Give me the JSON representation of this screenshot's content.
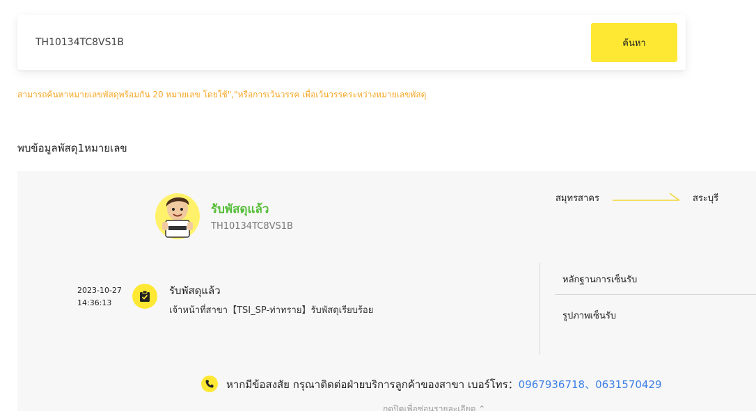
{
  "search": {
    "value": "TH10134TC8VS1B",
    "button_label": "ค้นหา"
  },
  "hint_text": "สามารถค้นหาหมายเลขพัสดุพร้อมกัน 20 หมายเลข โดยใช้\",\"หรือการเว้นวรรค เพื่อเว้นวรรคระหว่างหมายเลขพัสดุ",
  "results": {
    "found_text": "พบข้อมูลพัสดุ1หมายเลข",
    "status": "รับพัสดุแล้ว",
    "tracking_number": "TH10134TC8VS1B",
    "route": {
      "from": "สมุทรสาคร",
      "to": "สระบุรี"
    },
    "event": {
      "date": "2023-10-27",
      "time": "14:36:13",
      "title": "รับพัสดุแล้ว",
      "description": "เจ้าหน้าที่สาขา【TSI_SP-ท่าทราย】รับพัสดุเรียบร้อย"
    },
    "side_links": {
      "proof": "หลักฐานการเซ็นรับ",
      "photo": "รูปภาพเซ็นรับ"
    },
    "contact": {
      "text": "หากมีข้อสงสัย กรุณาติดต่อฝ่ายบริการลูกค้าของสาขา เบอร์โทร：",
      "phone1": "0967936718",
      "separator": "、",
      "phone2": "0631570429"
    },
    "collapse_label": "กดปิดเพื่อซ่อนรายละเอียด"
  },
  "colors": {
    "accent_yellow": "#fee833",
    "status_green": "#56be3a",
    "hint_orange": "#f6a623",
    "link_blue": "#3d7fe6"
  }
}
